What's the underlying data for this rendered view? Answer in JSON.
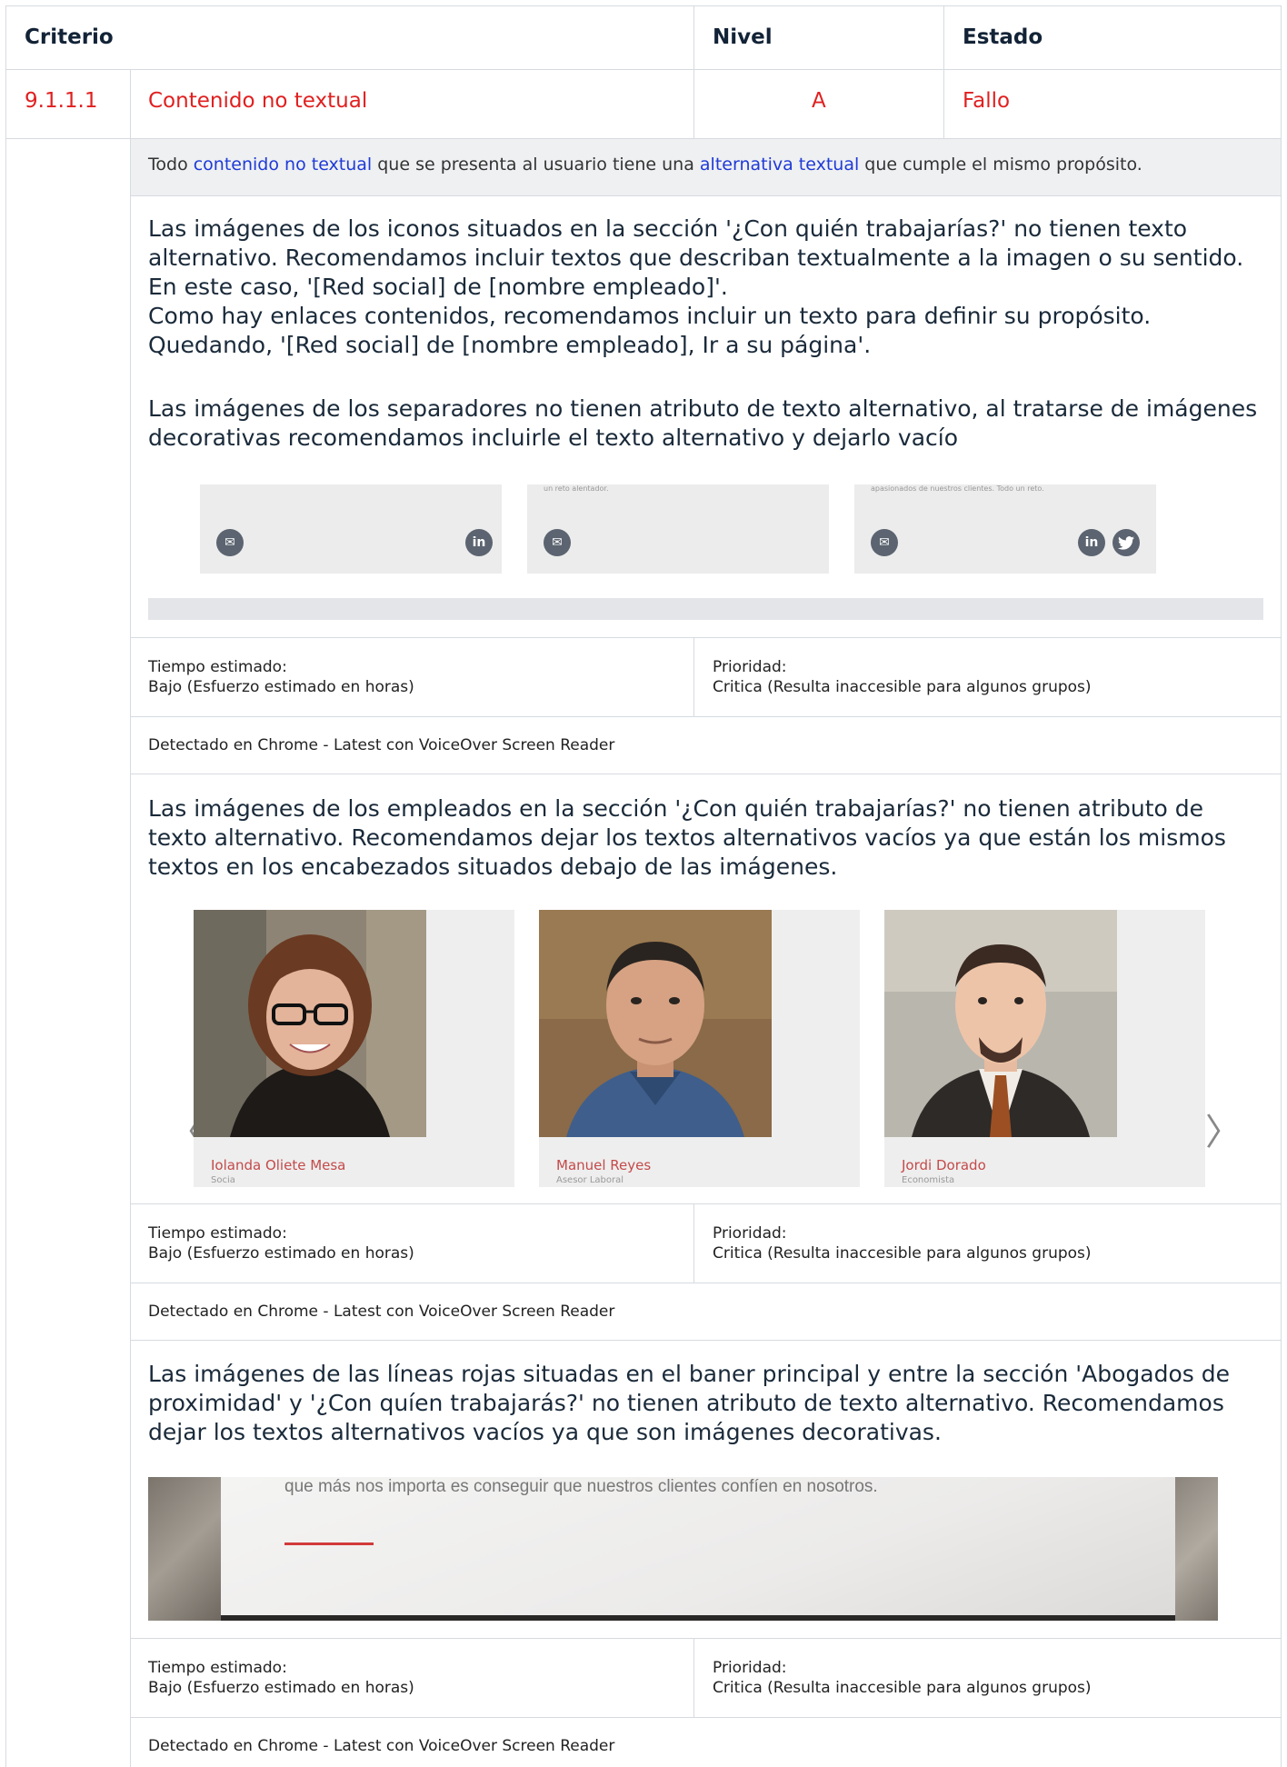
{
  "table": {
    "header": {
      "criterio": "Criterio",
      "nivel": "Nivel",
      "estado": "Estado"
    },
    "row": {
      "code": "9.1.1.1",
      "name": "Contenido no textual",
      "level": "A",
      "status": "Fallo"
    },
    "description": {
      "pre": "Todo ",
      "link1": "contenido no textual",
      "mid": " que se presenta al usuario tiene una ",
      "link2": "alternativa textual",
      "post": " que cumple el mismo propósito."
    }
  },
  "issues": [
    {
      "lines": [
        "Las imágenes de los iconos situados en la sección '¿Con quién trabajarías?' no tienen texto",
        "alternativo. Recomendamos incluir textos que describan textualmente a la imagen o su sentido.",
        "En este caso, '[Red social] de [nombre empleado]'.",
        "Como hay enlaces contenidos, recomendamos incluir un texto para definir su propósito.",
        "Quedando, '[Red social] de [nombre empleado], Ir a su página'."
      ],
      "lines2": [
        "Las imágenes de los separadores no tienen atributo de texto alternativo, al tratarse de imágenes",
        "decorativas recomendamos incluirle el texto alternativo y dejarlo vacío"
      ],
      "snippet": {
        "card_texts": [
          "un reto alentador.",
          "apasionados de nuestros clientes. Todo un reto."
        ]
      },
      "time_label": "Tiempo estimado:",
      "time_value": "Bajo (Esfuerzo estimado en horas)",
      "priority_label": "Prioridad:",
      "priority_value": "Critica (Resulta inaccesible para algunos grupos)",
      "detected": "Detectado en Chrome - Latest con VoiceOver Screen Reader"
    },
    {
      "lines": [
        "Las imágenes de los empleados en la sección '¿Con quién trabajarías?' no tienen atributo de",
        "texto alternativo. Recomendamos dejar los textos alternativos vacíos ya que están los mismos",
        "textos en los encabezados situados debajo de las imágenes."
      ],
      "employees": [
        {
          "name": "Iolanda Oliete Mesa",
          "role": "Socia"
        },
        {
          "name": "Manuel Reyes",
          "role": "Asesor Laboral"
        },
        {
          "name": "Jordi Dorado",
          "role": "Economista"
        }
      ],
      "arrows": {
        "prev": "〈",
        "next": "〉"
      },
      "time_label": "Tiempo estimado:",
      "time_value": "Bajo (Esfuerzo estimado en horas)",
      "priority_label": "Prioridad:",
      "priority_value": "Critica (Resulta inaccesible para algunos grupos)",
      "detected": "Detectado en Chrome - Latest con VoiceOver Screen Reader"
    },
    {
      "lines": [
        "Las imágenes de las líneas rojas situadas en el baner principal y entre la sección 'Abogados de",
        "proximidad' y '¿Con quíen trabajarás?' no tienen atributo de texto alternativo. Recomendamos",
        "dejar los textos alternativos vacíos ya que son imágenes decorativas."
      ],
      "banner_text": "que más nos importa es conseguir que nuestros clientes confíen en nosotros.",
      "time_label": "Tiempo estimado:",
      "time_value": "Bajo (Esfuerzo estimado en horas)",
      "priority_label": "Prioridad:",
      "priority_value": "Critica (Resulta inaccesible para algunos grupos)",
      "detected": "Detectado en Chrome - Latest con VoiceOver Screen Reader"
    }
  ]
}
